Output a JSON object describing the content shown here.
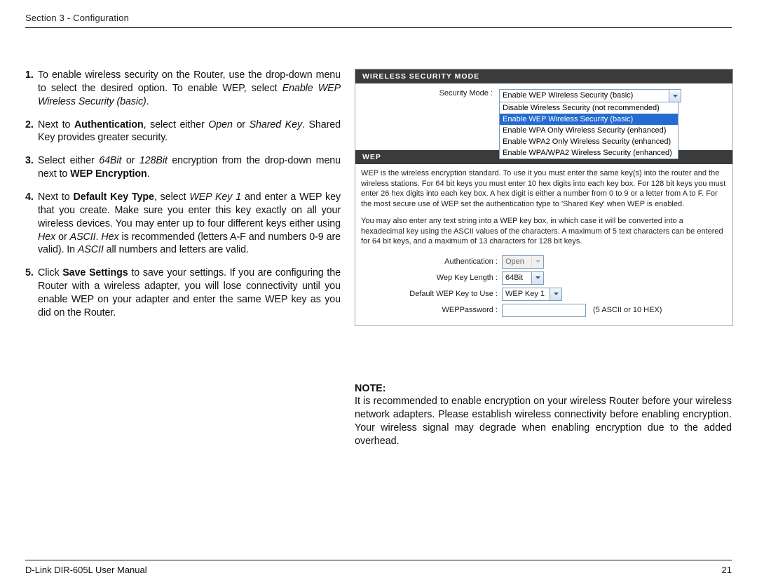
{
  "header": {
    "section": "Section 3 - Configuration"
  },
  "steps": {
    "s1_a": "To enable wireless security on the Router, use the drop-down menu to select the desired option. To enable WEP, select ",
    "s1_em": "Enable WEP Wireless Security (basic)",
    "s1_c": ".",
    "s2_a": "Next to ",
    "s2_b_strong": "Authentication",
    "s2_c": ", select either ",
    "s2_d_em": "Open",
    "s2_e": "  or ",
    "s2_f_em": "Shared Key",
    "s2_g": ". Shared Key provides greater security.",
    "s3_a": "Select either ",
    "s3_b_em": "64Bit",
    "s3_c": " or ",
    "s3_d_em": "128Bit",
    "s3_e": " encryption from the drop-down menu next to ",
    "s3_f_strong": "WEP Encryption",
    "s3_g": ".",
    "s4_a": "Next to ",
    "s4_b_strong": "Default Key Type",
    "s4_c": ", select ",
    "s4_d_em": "WEP Key 1",
    "s4_e": " and enter a WEP key that you create. Make sure you enter this key exactly on all your wireless devices. You may enter up to four different keys either using ",
    "s4_f_em": "Hex",
    "s4_g": " or ",
    "s4_h_em": "ASCII",
    "s4_i": ". ",
    "s4_j_em": "Hex",
    "s4_k": " is recommended (letters A-F and numbers 0-9 are valid). In ",
    "s4_l_em": "ASCII",
    "s4_m": " all numbers and letters are valid.",
    "s5_a": "Click ",
    "s5_b_strong": "Save Settings",
    "s5_c": " to save your settings. If you are configuring the Router with a wireless adapter, you will lose connectivity until you enable WEP on your adapter and enter the same WEP key as you did on the Router."
  },
  "ui": {
    "wsm_head": "WIRELESS SECURITY MODE",
    "wep_head": "WEP",
    "sec_mode_label": "Security Mode :",
    "sec_mode_value": "Enable WEP Wireless Security (basic)",
    "dd_opt1": "Disable Wireless Security (not recommended)",
    "dd_opt2": "Enable WEP Wireless Security (basic)",
    "dd_opt3": "Enable WPA Only Wireless Security (enhanced)",
    "dd_opt4": "Enable WPA2 Only Wireless Security (enhanced)",
    "dd_opt5": "Enable WPA/WPA2 Wireless Security (enhanced)",
    "expl1": "WEP is the wireless encryption standard. To use it you must enter the same key(s) into the router and the wireless stations. For 64 bit keys you must enter 10 hex digits into each key box. For 128 bit keys you must enter 26 hex digits into each key box. A hex digit is either a number from 0 to 9 or a letter from A to F. For the most secure use of WEP set the authentication type to 'Shared Key' when WEP is enabled.",
    "expl2": "You may also enter any text string into a WEP key box, in which case it will be converted into a hexadecimal key using the ASCII values of the characters. A maximum of 5 text characters can be entered for 64 bit keys, and a maximum of 13 characters for 128 bit keys.",
    "auth_label": "Authentication :",
    "auth_value": "Open",
    "keylen_label": "Wep Key Length :",
    "keylen_value": "64Bit",
    "defkey_label": "Default WEP Key to Use :",
    "defkey_value": "WEP Key 1",
    "pw_label": "WEPPassword :",
    "pw_hint": "(5 ASCII or 10 HEX)"
  },
  "note": {
    "head": "NOTE:",
    "body": "It is recommended to enable encryption on your wireless Router before your wireless network adapters. Please establish wireless connectivity before enabling encryption. Your wireless signal may degrade when enabling encryption due to the added overhead."
  },
  "footer": {
    "left": "D-Link DIR-605L User Manual",
    "right": "21"
  },
  "colors": {
    "highlight": "#246cd1",
    "panel_head": "#3b3b3b"
  }
}
